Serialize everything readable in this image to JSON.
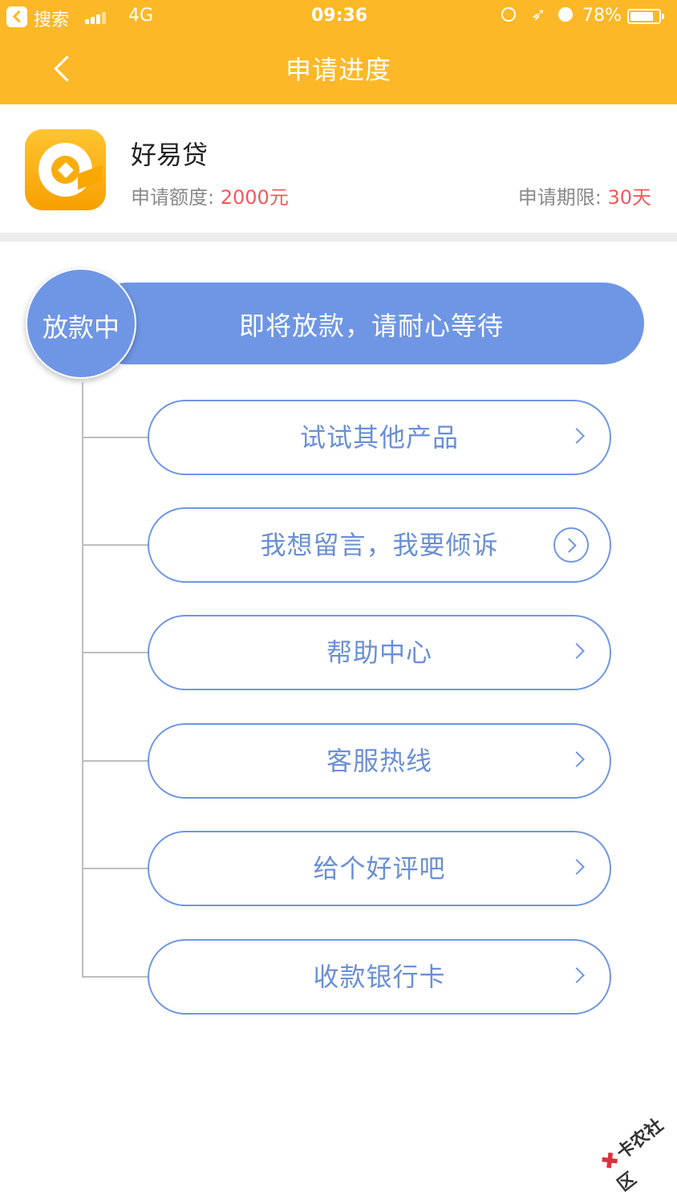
{
  "status_bar": {
    "app_label": "搜索",
    "network": "4G",
    "time": "09:36",
    "battery": "78%"
  },
  "nav": {
    "title": "申请进度"
  },
  "product": {
    "name": "好易贷",
    "amount_label": "申请额度:",
    "amount_value": "2000元",
    "term_label": "申请期限:",
    "term_value": "30天"
  },
  "status": {
    "stage": "放款中",
    "message": "即将放款，请耐心等待"
  },
  "actions": [
    {
      "label": "试试其他产品"
    },
    {
      "label": "我想留言，我要倾诉"
    },
    {
      "label": "帮助中心"
    },
    {
      "label": "客服热线"
    },
    {
      "label": "给个好评吧"
    },
    {
      "label": "收款银行卡"
    }
  ],
  "watermark": {
    "text": "卡农社区"
  },
  "colors": {
    "header": "#fdb827",
    "accent_blue": "#6f96e4",
    "highlight_red": "#ef5b5b"
  },
  "icons": {
    "back": "chevron-left-icon",
    "chevron": "chevron-right-icon",
    "message": "chevron-right-circle-icon"
  }
}
